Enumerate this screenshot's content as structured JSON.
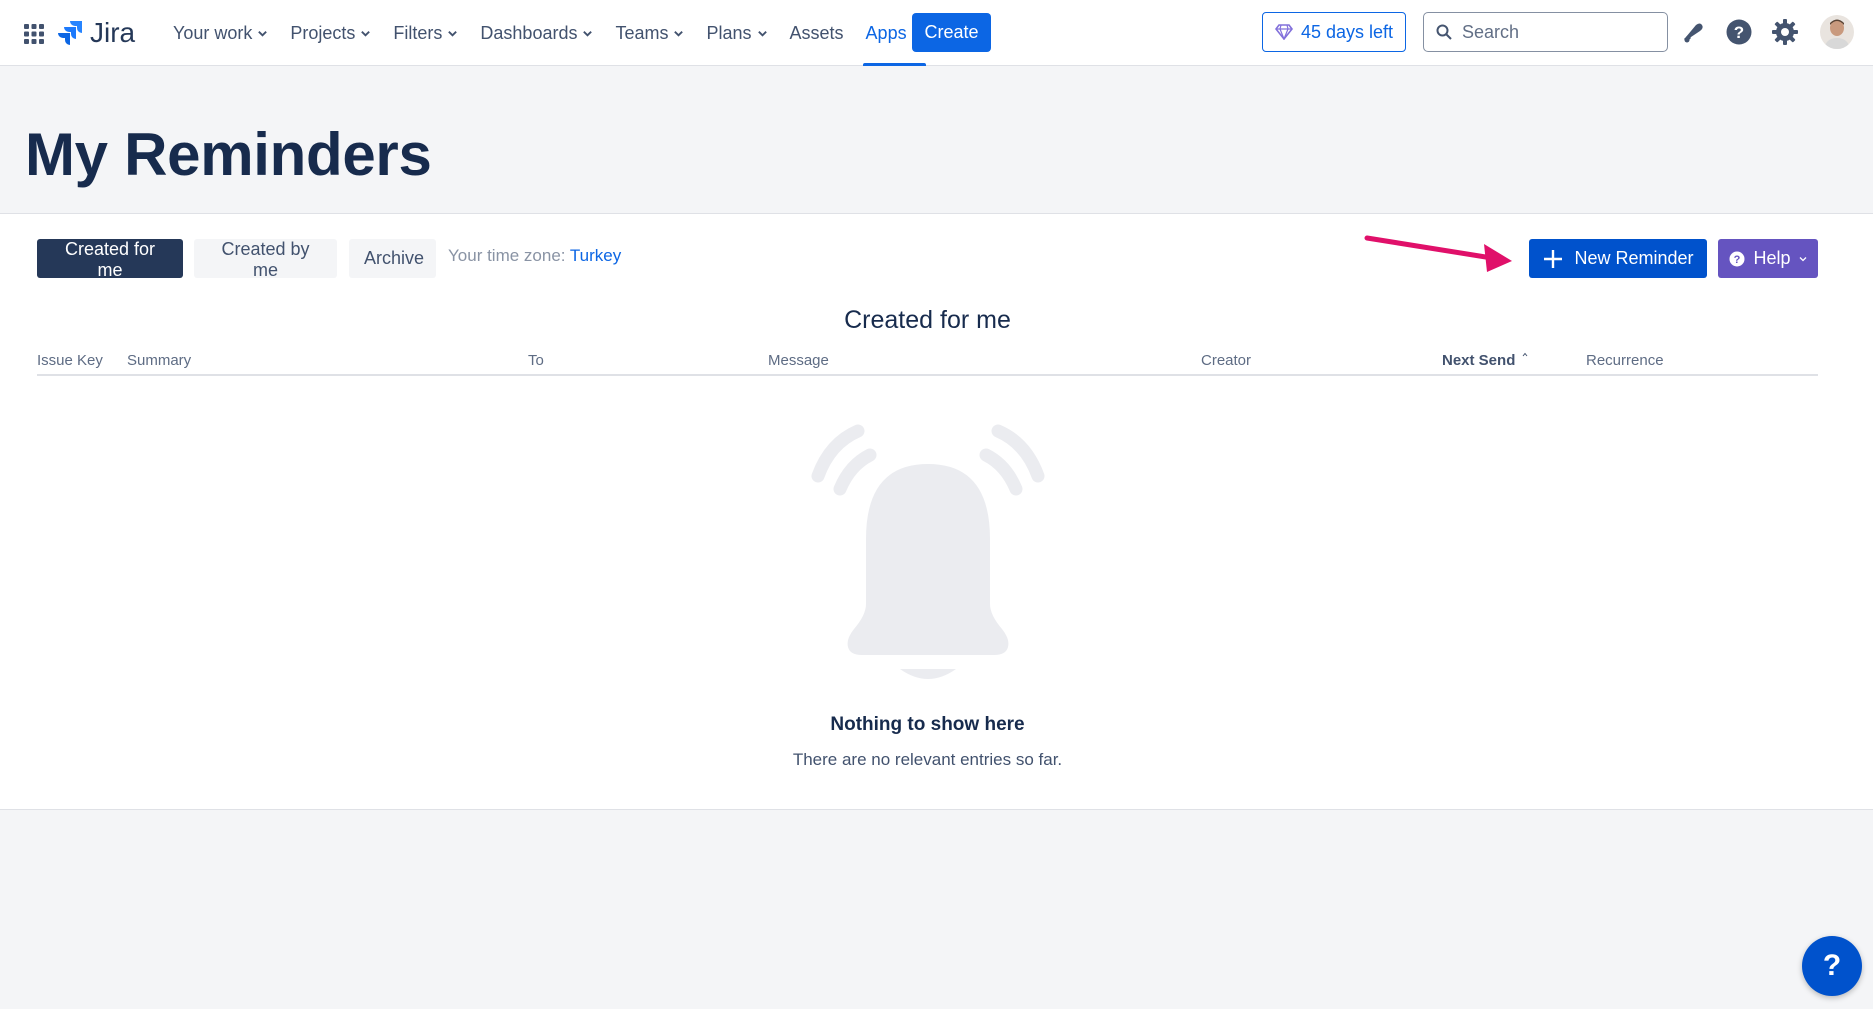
{
  "nav": {
    "app_name": "Jira",
    "items": [
      {
        "label": "Your work",
        "dropdown": true
      },
      {
        "label": "Projects",
        "dropdown": true
      },
      {
        "label": "Filters",
        "dropdown": true
      },
      {
        "label": "Dashboards",
        "dropdown": true
      },
      {
        "label": "Teams",
        "dropdown": true
      },
      {
        "label": "Plans",
        "dropdown": true
      },
      {
        "label": "Assets",
        "dropdown": false
      },
      {
        "label": "Apps",
        "dropdown": true,
        "active": true
      }
    ],
    "create_label": "Create",
    "trial_label": "45 days left",
    "search_placeholder": "Search",
    "icons": [
      "app-switcher-icon",
      "notifications-icon",
      "help-icon",
      "settings-icon",
      "avatar"
    ]
  },
  "page": {
    "title": "My Reminders"
  },
  "toolbar": {
    "tabs": [
      "Created for me",
      "Created by me",
      "Archive"
    ],
    "active_tab": "Created for me",
    "timezone_label": "Your time zone:",
    "timezone_value": "Turkey",
    "new_reminder_label": "New Reminder",
    "help_label": "Help"
  },
  "table": {
    "title": "Created for me",
    "columns": [
      "Issue Key",
      "Summary",
      "To",
      "Message",
      "Creator",
      "Next Send",
      "Recurrence"
    ],
    "sorted_column": "Next Send",
    "rows": []
  },
  "empty_state": {
    "title": "Nothing to show here",
    "subtitle": "There are no relevant entries so far."
  },
  "floating_help": {
    "label": "?"
  },
  "colors": {
    "primary": "#0c66e4",
    "button_blue": "#0052cc",
    "help_purple": "#6554c0",
    "active_tab": "#253858",
    "annotation_arrow": "#e0106a"
  }
}
